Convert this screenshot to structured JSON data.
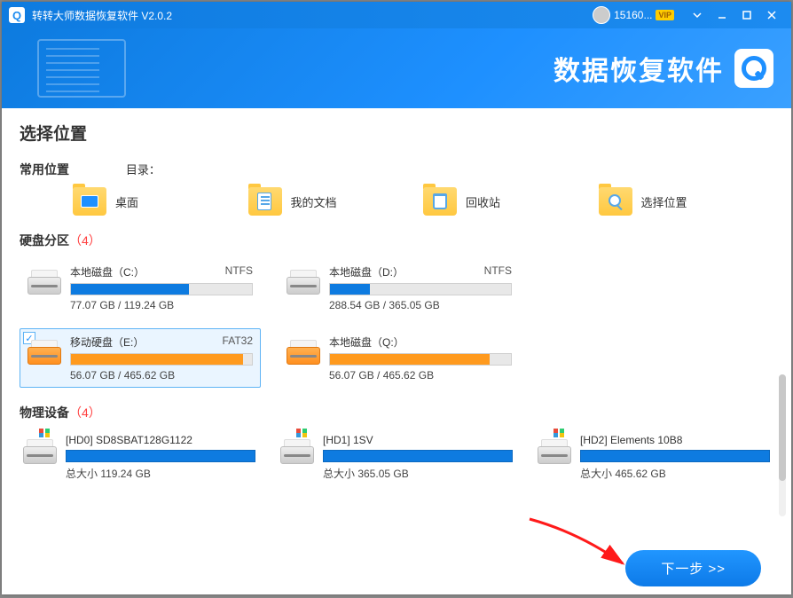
{
  "titlebar": {
    "logo_letter": "Q",
    "title": "转转大师数据恢复软件 V2.0.2",
    "username": "15160...",
    "vip_label": "VIP"
  },
  "header": {
    "brand_text": "数据恢复软件"
  },
  "main": {
    "page_title": "选择位置",
    "common_label": "常用位置",
    "dir_label": "目录：",
    "common_items": [
      {
        "label": "桌面"
      },
      {
        "label": "我的文档"
      },
      {
        "label": "回收站"
      },
      {
        "label": "选择位置"
      }
    ],
    "partitions_label": "硬盘分区",
    "partitions_count": "（4）",
    "partitions": [
      {
        "name": "本地磁盘（C:）",
        "fs": "NTFS",
        "size": "77.07 GB / 119.24 GB",
        "fill_pct": 65,
        "color": "blue",
        "selected": false
      },
      {
        "name": "本地磁盘（D:）",
        "fs": "NTFS",
        "size": "288.54 GB / 365.05 GB",
        "fill_pct": 22,
        "color": "blue",
        "selected": false
      },
      {
        "name": "移动硬盘（E:）",
        "fs": "FAT32",
        "size": "56.07 GB / 465.62 GB",
        "fill_pct": 95,
        "color": "orange",
        "selected": true
      },
      {
        "name": "本地磁盘（Q:）",
        "fs": "",
        "size": "56.07 GB / 465.62 GB",
        "fill_pct": 88,
        "color": "orange",
        "selected": false
      }
    ],
    "physical_label": "物理设备",
    "physical_count": "（4）",
    "physical": [
      {
        "name": "[HD0] SD8SBAT128G1122",
        "size_label": "总大小 119.24 GB"
      },
      {
        "name": "[HD1] 1SV",
        "size_label": "总大小 365.05 GB"
      },
      {
        "name": "[HD2] Elements 10B8",
        "size_label": "总大小 465.62 GB"
      }
    ]
  },
  "footer": {
    "next_label": "下一步 >>"
  },
  "colors": {
    "primary": "#0e7be0",
    "orange": "#ff9a1e"
  }
}
